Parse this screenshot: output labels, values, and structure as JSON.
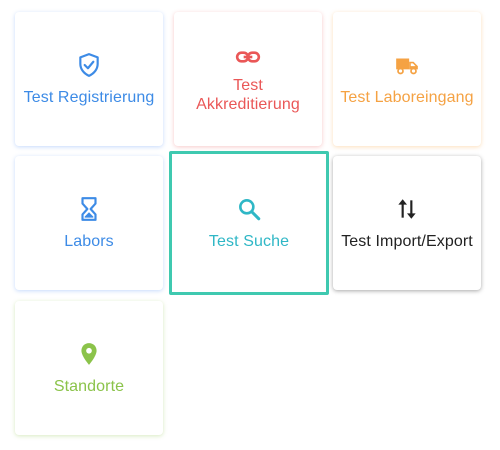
{
  "tiles": [
    {
      "label": "Test Registrierung",
      "icon": "shield-check-icon",
      "color": "#3d8be6"
    },
    {
      "label": "Test Akkreditierung",
      "icon": "link-icon",
      "color": "#ea5757"
    },
    {
      "label": "Test Laboreingang",
      "icon": "truck-icon",
      "color": "#f5a243"
    },
    {
      "label": "Labors",
      "icon": "hourglass-icon",
      "color": "#3d8be6"
    },
    {
      "label": "Test Suche",
      "icon": "search-icon",
      "color": "#2fb7c6",
      "selected": true
    },
    {
      "label": "Test Import/Export",
      "icon": "swap-vertical-icon",
      "color": "#222222"
    },
    {
      "label": "Standorte",
      "icon": "map-pin-icon",
      "color": "#8bc34a"
    }
  ]
}
